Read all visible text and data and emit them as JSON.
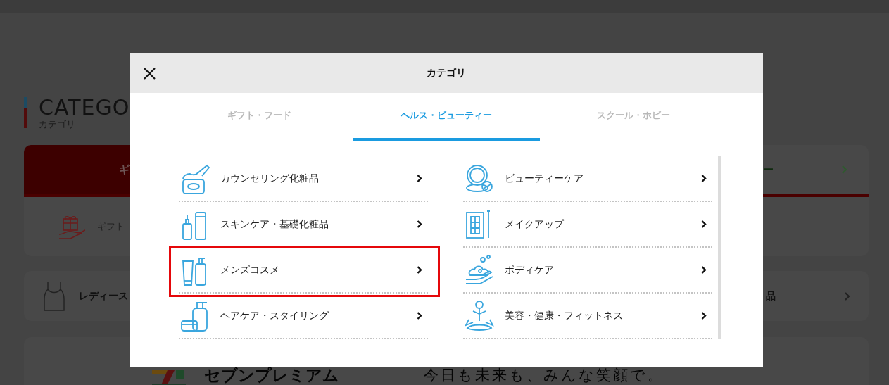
{
  "background_page": {
    "heading": "CATEGO",
    "subheading": "カテゴリ",
    "tabs": [
      {
        "label": "ギ",
        "selected": true
      },
      {
        "label": "ー",
        "selected": false
      }
    ],
    "rows": [
      {
        "label": "ギフト"
      },
      {
        "label": "レディース"
      },
      {
        "label": "品"
      }
    ],
    "brand": {
      "name": "セブンプレミアム",
      "slogan": "今日も未来も、みんな笑顔で。"
    }
  },
  "dialog": {
    "title": "カテゴリ",
    "tabs": [
      {
        "label": "ギフト・フード",
        "selected": false
      },
      {
        "label": "ヘルス・ビューティー",
        "selected": true
      },
      {
        "label": "スクール・ホビー",
        "selected": false
      }
    ],
    "columns": [
      {
        "items": [
          {
            "label": "カウンセリング化粧品",
            "highlighted": false
          },
          {
            "label": "スキンケア・基礎化粧品",
            "highlighted": false
          },
          {
            "label": "メンズコスメ",
            "highlighted": true
          },
          {
            "label": "ヘアケア・スタイリング",
            "highlighted": false
          }
        ]
      },
      {
        "items": [
          {
            "label": "ビューティーケア",
            "highlighted": false
          },
          {
            "label": "メイクアップ",
            "highlighted": false
          },
          {
            "label": "ボディケア",
            "highlighted": false
          },
          {
            "label": "美容・健康・フィットネス",
            "highlighted": false
          }
        ]
      }
    ]
  }
}
